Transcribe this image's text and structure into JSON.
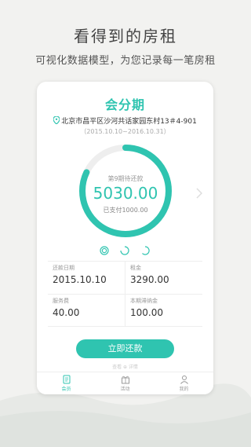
{
  "promo": {
    "title": "看得到的房租",
    "subtitle": "可视化数据模型，为您记录每一笔房租"
  },
  "app": {
    "logo": "会分期",
    "address": "北京市昌平区沙河共话家园东村13＃4-901",
    "period": "（2015.10.10~2016.10.31）",
    "ring": {
      "label": "第9期待还款",
      "amount": "5030.00",
      "paid": "已支付1000.00",
      "progress": 0.82
    },
    "details": {
      "due_date_label": "还款日期",
      "due_date": "2015.10.10",
      "rent_label": "租金",
      "rent": "3290.00",
      "service_fee_label": "服务费",
      "service_fee": "40.00",
      "late_fee_label": "本期滞纳金",
      "late_fee": "100.00"
    },
    "pay_button": "立即还款",
    "faint_text": "查看 ⊕ 详情",
    "tabs": [
      {
        "label": "会员",
        "icon": "doc-icon",
        "active": true
      },
      {
        "label": "活动",
        "icon": "gift-icon",
        "active": false
      },
      {
        "label": "我的",
        "icon": "user-icon",
        "active": false
      }
    ],
    "colors": {
      "accent": "#2fc4b0",
      "ring_track": "#eeeeee"
    }
  }
}
